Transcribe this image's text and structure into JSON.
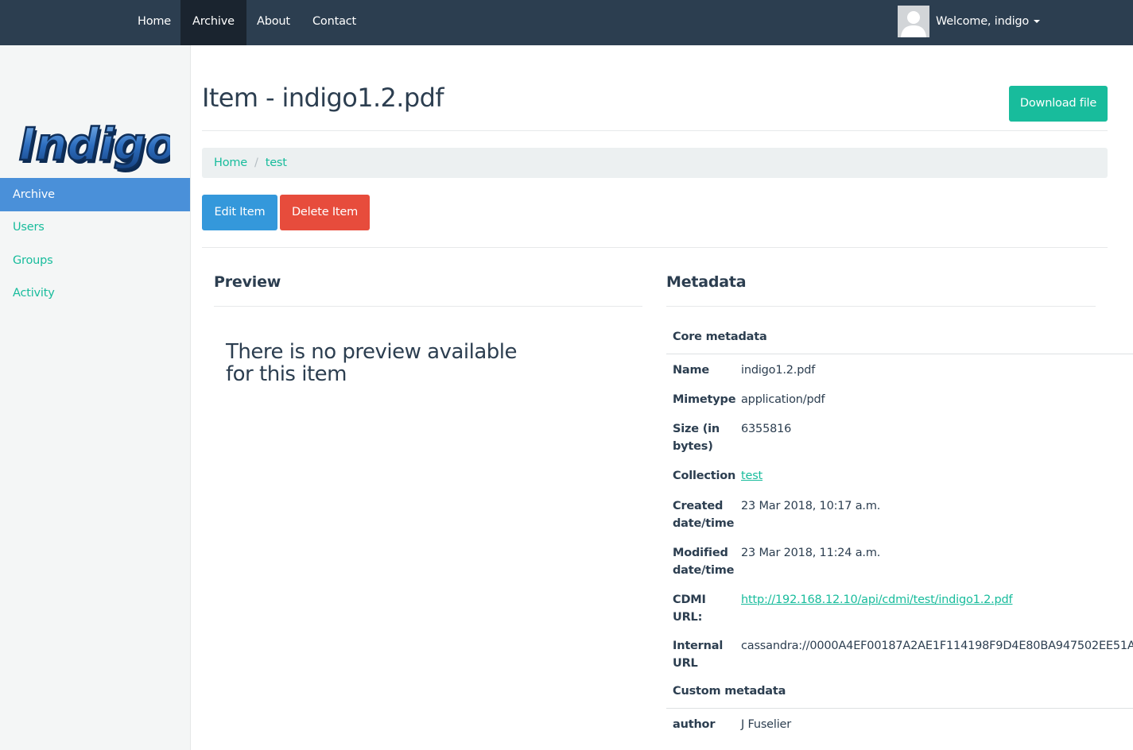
{
  "nav": {
    "links": [
      "Home",
      "Archive",
      "About",
      "Contact"
    ],
    "user_label": "Welcome, indigo"
  },
  "sidebar": {
    "logo_text": "Indigo",
    "items": [
      "Archive",
      "Users",
      "Groups",
      "Activity"
    ],
    "active_item": "Archive"
  },
  "main": {
    "title": "Item - indigo1.2.pdf",
    "download_label": "Download file",
    "breadcrumb": [
      "Home",
      "test"
    ],
    "edit_label": "Edit Item",
    "delete_label": "Delete Item"
  },
  "preview": {
    "heading": "Preview",
    "message": "There is no preview available for this item"
  },
  "metadata": {
    "heading": "Metadata",
    "core_heading": "Core metadata",
    "core": [
      {
        "key": "Name",
        "value": "indigo1.2.pdf"
      },
      {
        "key": "Mimetype",
        "value": "application/pdf"
      },
      {
        "key": "Size (in bytes)",
        "value": "6355816"
      },
      {
        "key": "Collection",
        "value": "test"
      },
      {
        "key": "Created date/time",
        "value": "23 Mar 2018, 10:17 a.m."
      },
      {
        "key": "Modified date/time",
        "value": "23 Mar 2018, 11:24 a.m."
      },
      {
        "key": "CDMI URL:",
        "value": "http://192.168.12.10/api/cdmi/test/indigo1.2.pdf"
      },
      {
        "key": "Internal URL",
        "value": "cassandra://0000A4EF00187A2AE1F114198F9D4E80BA947502EE51A"
      }
    ],
    "custom_heading": "Custom metadata",
    "custom": [
      {
        "key": "author",
        "value": "J Fuselier"
      }
    ]
  },
  "colors": {
    "navbar": "#2c3e50",
    "accent": "#18bc9c",
    "primary": "#3498db",
    "danger": "#e74c3c",
    "sidebar_active": "#4a90d9"
  }
}
